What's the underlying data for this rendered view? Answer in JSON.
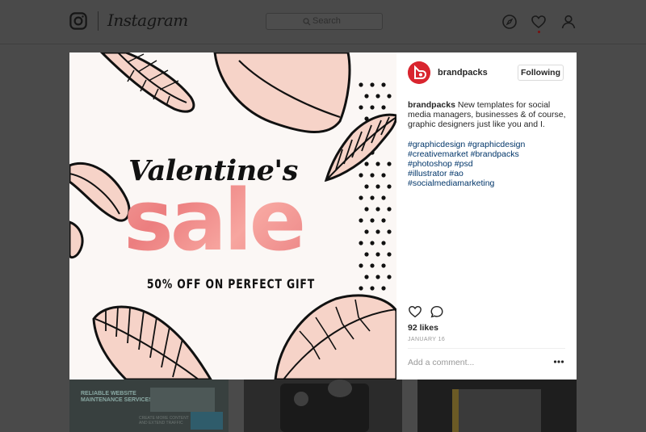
{
  "header": {
    "app_name": "Instagram",
    "search_placeholder": "Search"
  },
  "post": {
    "image": {
      "line1": "Valentine's",
      "line2": "sale",
      "line3": "50% OFF ON PERFECT GIFT"
    },
    "author": "brandpacks",
    "follow_label": "Following",
    "caption_user": "brandpacks",
    "caption_text": " New templates for social media managers, businesses & of course, graphic designers just like you and I.",
    "hashtags": [
      "#graphicdesign #graphicdesign",
      "#creativemarket #brandpacks",
      "#photoshop #psd",
      "#illustrator #ao",
      "#socialmediamarketing"
    ],
    "likes": "92 likes",
    "date": "JANUARY 16",
    "comment_placeholder": "Add a comment..."
  },
  "grid": {
    "thumb1_title": [
      "RELIABLE WEBSITE",
      "MAINTENANCE SERVICES"
    ],
    "thumb1_sub": [
      "CREATE MORE CONTENT",
      "AND EXTEND TRAFFIC"
    ]
  },
  "colors": {
    "avatar": "#d9252f",
    "sale_gradient": "#ef8e8e",
    "hashtag": "#003569"
  },
  "icons": {
    "logo": "instagram-camera-icon",
    "explore": "compass-icon",
    "activity": "heart-icon",
    "profile": "person-icon",
    "like": "heart-outline-icon",
    "comment": "speech-bubble-icon",
    "more": "more-dots-icon"
  }
}
